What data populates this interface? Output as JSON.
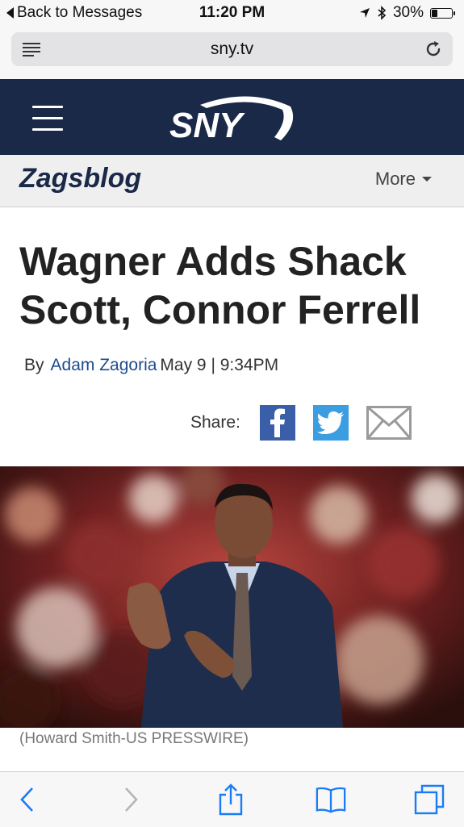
{
  "status_bar": {
    "back_label": "Back to Messages",
    "time": "11:20 PM",
    "battery_percent": "30%",
    "battery_level": 0.3,
    "icons": [
      "location-arrow-icon",
      "bluetooth-icon",
      "battery-icon"
    ]
  },
  "browser": {
    "url": "sny.tv",
    "icons": [
      "reader-view-icon",
      "reload-icon"
    ]
  },
  "site_header": {
    "logo_text": "SNY",
    "background": "#1b2948"
  },
  "section_bar": {
    "brand": "Zagsblog",
    "more_label": "More"
  },
  "article": {
    "headline": "Wagner Adds Shack Scott, Connor Ferrell",
    "by_label": "By",
    "author": "Adam Zagoria",
    "date": "May 9 | 9:34PM",
    "share_label": "Share:",
    "share_buttons": [
      "facebook-icon",
      "twitter-icon",
      "email-icon"
    ],
    "photo_caption": "(Howard Smith-US PRESSWIRE)"
  },
  "bottom_toolbar": {
    "icons": [
      "back-icon",
      "forward-icon",
      "share-icon",
      "bookmarks-icon",
      "tabs-icon"
    ]
  },
  "colors": {
    "header_navy": "#1b2948",
    "facebook_blue": "#3b5ea8",
    "twitter_blue": "#3a9ee0",
    "safari_blue": "#1a7cf5",
    "author_link": "#1e4b8c"
  }
}
